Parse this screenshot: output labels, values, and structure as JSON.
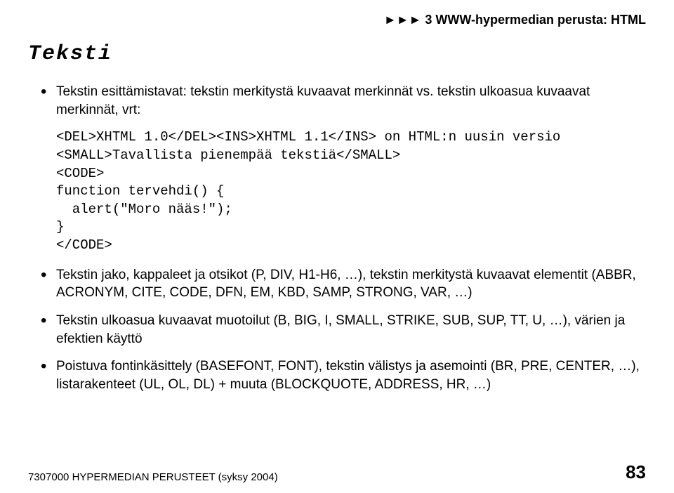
{
  "header": {
    "arrows": "►►►",
    "text": "3 WWW-hypermedian perusta: HTML"
  },
  "title": "Teksti",
  "bullets": {
    "item1": "Tekstin esittämistavat: tekstin merkitystä kuvaavat merkinnät vs. tekstin ulkoasua kuvaavat merkinnät, vrt:",
    "item2": "Tekstin jako, kappaleet ja otsikot (P, DIV, H1-H6, …), tekstin merkitystä kuvaavat elementit (ABBR, ACRONYM, CITE, CODE, DFN, EM, KBD, SAMP, STRONG, VAR, …)",
    "item3": "Tekstin ulkoasua kuvaavat muotoilut (B, BIG, I, SMALL, STRIKE, SUB, SUP, TT, U, …), värien ja efektien käyttö",
    "item4": "Poistuva fontinkäsittely (BASEFONT, FONT), tekstin välistys ja asemointi (BR, PRE, CENTER, …), listarakenteet (UL, OL, DL) + muuta (BLOCKQUOTE, ADDRESS, HR, …)"
  },
  "code": "<DEL>XHTML 1.0</DEL><INS>XHTML 1.1</INS> on HTML:n uusin versio\n<SMALL>Tavallista pienempää tekstiä</SMALL>\n<CODE>\nfunction tervehdi() {\n  alert(\"Moro nääs!\");\n}\n</CODE>",
  "footer": {
    "left": "7307000 HYPERMEDIAN PERUSTEET (syksy 2004)",
    "page": "83"
  }
}
